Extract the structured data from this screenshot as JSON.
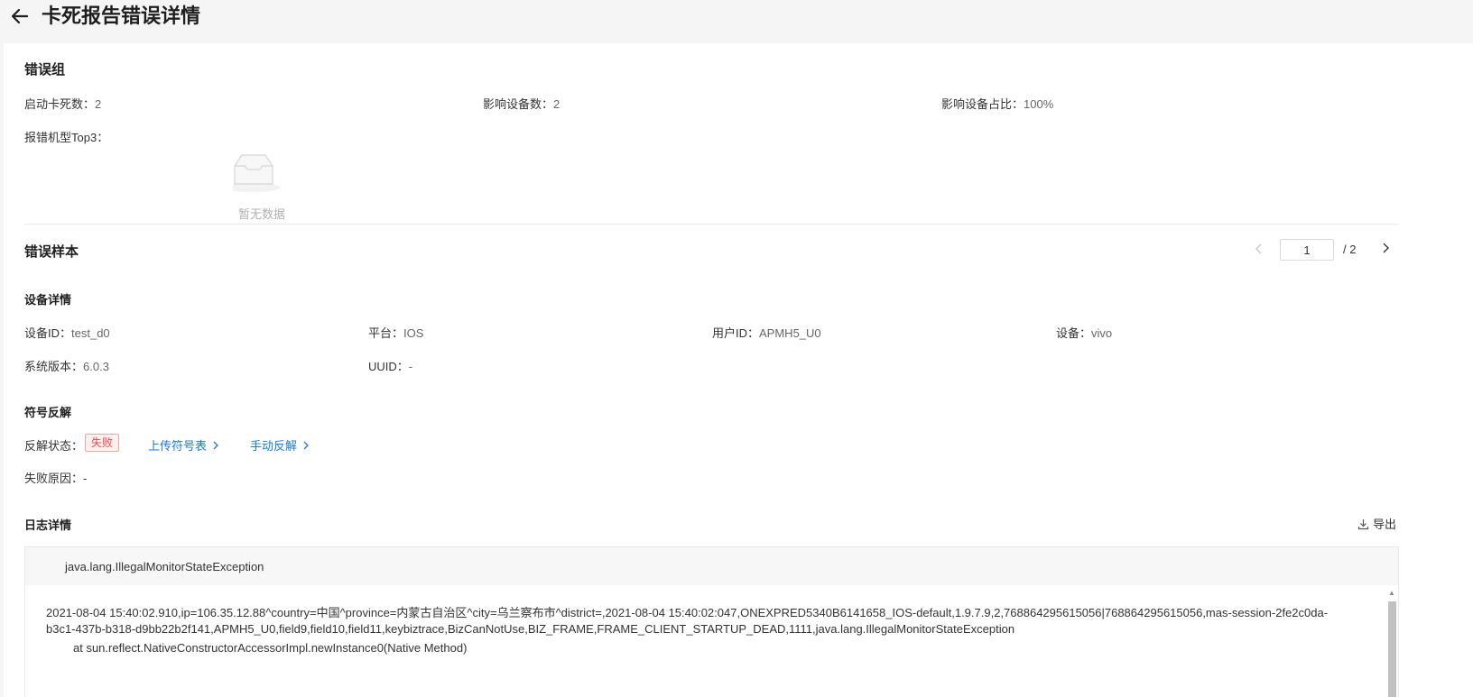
{
  "header": {
    "title": "卡死报告错误详情",
    "back_icon": "arrow-left-icon"
  },
  "error_group": {
    "title": "错误组",
    "startup_freeze_label": "启动卡死数：",
    "startup_freeze_value": "2",
    "affected_devices_label": "影响设备数：",
    "affected_devices_value": "2",
    "affected_ratio_label": "影响设备占比：",
    "affected_ratio_value": "100%",
    "top_models_label": "报错机型Top3：",
    "empty_text": "暂无数据"
  },
  "sample": {
    "title": "错误样本",
    "pager": {
      "current": "1",
      "total": "/ 2"
    }
  },
  "device": {
    "title": "设备详情",
    "device_id_label": "设备ID：",
    "device_id_value": "test_d0",
    "platform_label": "平台：",
    "platform_value": "IOS",
    "user_id_label": "用户ID：",
    "user_id_value": "APMH5_U0",
    "device_label": "设备：",
    "device_value": "vivo",
    "os_version_label": "系统版本：",
    "os_version_value": "6.0.3",
    "uuid_label": "UUID：",
    "uuid_value": "-"
  },
  "symbol": {
    "title": "符号反解",
    "status_label": "反解状态：",
    "status_badge": "失败",
    "upload_link": "上传符号表",
    "manual_link": "手动反解",
    "reason_label": "失败原因：",
    "reason_value": "-"
  },
  "log": {
    "title": "日志详情",
    "export_label": "导出",
    "exception_name": "java.lang.IllegalMonitorStateException",
    "lines": [
      "2021-08-04 15:40:02.910,ip=106.35.12.88^country=中国^province=内蒙古自治区^city=乌兰察布市^district=,2021-08-04 15:40:02:047,ONEXPRED5340B6141658_IOS-default,1.9.7.9,2,768864295615056|768864295615056,mas-session-2fe2c0da-",
      "b3c1-437b-b318-d9bb22b2f141,APMH5_U0,field9,field10,field11,keybiztrace,BizCanNotUse,BIZ_FRAME,FRAME_CLIENT_STARTUP_DEAD,1111,java.lang.IllegalMonitorStateException",
      "at sun.reflect.NativeConstructorAccessorImpl.newInstance0(Native Method)"
    ]
  }
}
